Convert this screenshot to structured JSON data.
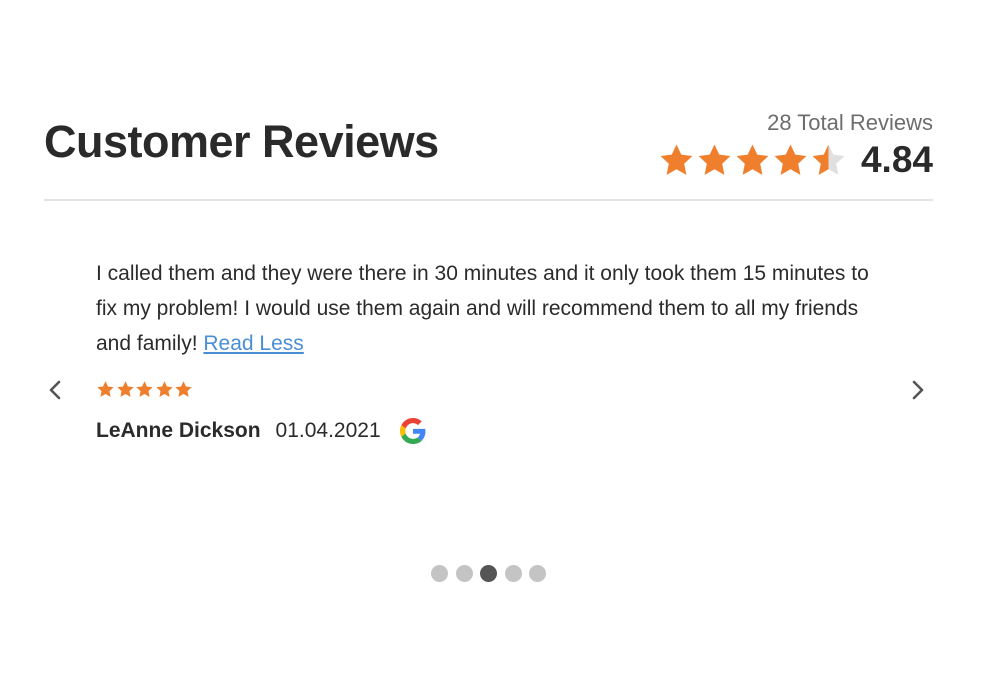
{
  "header": {
    "title": "Customer Reviews",
    "total_reviews": "28 Total Reviews",
    "average_rating": "4.84",
    "average_rating_value": 4.84,
    "star_color": "#ef7f2d",
    "star_empty_color": "#e0e0e0"
  },
  "review": {
    "text": "I called them and they were there in 30 minutes and it only took them 15 minutes to fix my problem! I would use them again and will recommend them to all my friends and family!",
    "read_less_label": "Read Less",
    "stars": 5,
    "author": "LeAnne Dickson",
    "date": "01.04.2021",
    "source_icon": "google-icon"
  },
  "carousel": {
    "prev_icon": "chevron-left-icon",
    "next_icon": "chevron-right-icon",
    "dot_count": 5,
    "active_index": 2
  }
}
